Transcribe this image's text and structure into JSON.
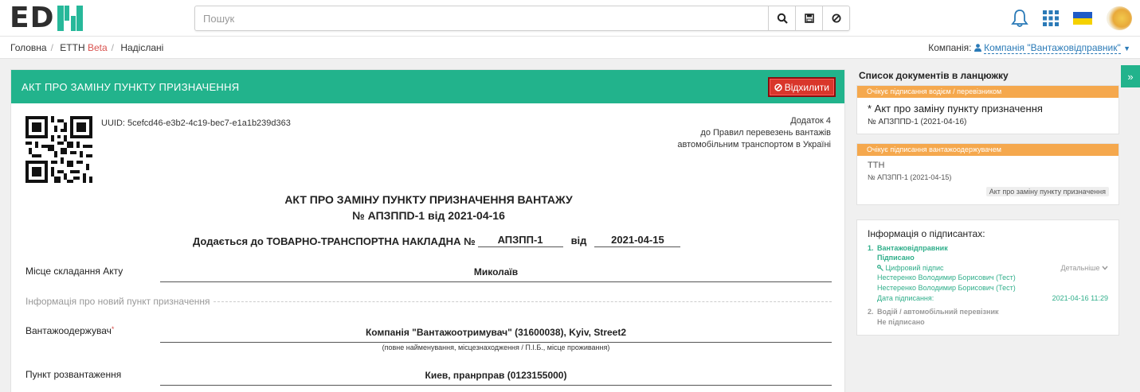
{
  "header": {
    "logo_text": "ED",
    "logo_letter_n": "N",
    "search_placeholder": "Пошук",
    "search_icons": [
      "search-icon",
      "save-icon",
      "clear-icon"
    ],
    "right_icons": [
      "bell-icon",
      "apps-grid-icon",
      "flag-ua-icon",
      "avatar"
    ],
    "accent_color": "#22b38c"
  },
  "breadcrumbs": {
    "home": "Головна",
    "section": "ЕТТН",
    "beta": "Beta",
    "current": "Надіслані"
  },
  "company": {
    "label": "Компанія:",
    "value": "Компанія \"Вантажовідправник\""
  },
  "document": {
    "header_title": "АКТ ПРО ЗАМІНУ ПУНКТУ ПРИЗНАЧЕННЯ",
    "reject_label": "Відхилити",
    "uuid": "UUID: 5cefcd46-e3b2-4c19-bec7-e1a1b239d363",
    "addendum": [
      "Додаток 4",
      "до Правил перевезень вантажів",
      "автомобільним транспортом в Україні"
    ],
    "title_line1": "АКТ ПРО ЗАМІНУ ПУНКТУ ПРИЗНАЧЕННЯ ВАНТАЖУ",
    "title_line2": "№ АПЗППD-1 від 2021-04-16",
    "ttn_prefix": "Додається до ТОВАРНО-ТРАНСПОРТНА НАКЛАДНА №",
    "ttn_number": "АПЗПП-1",
    "ttn_from": "від",
    "ttn_date": "2021-04-15",
    "place_label": "Місце складання Акту",
    "place_value": "Миколаїв",
    "new_point_section": "Інформація про новий пункт призначення",
    "consignee_label": "Вантажоодержувач",
    "consignee_required": "*",
    "consignee_value": "Компанія \"Вантажоотримувач\" (31600038), Kyiv, Street2",
    "consignee_hint": "(повне найменування, місцезнаходження / П.І.Б., місце проживання)",
    "unload_label": "Пункт розвантаження",
    "unload_value": "Киев, пранрправ (0123155000)"
  },
  "chain": {
    "title": "Список документів в ланцюжку",
    "toggle": "»",
    "cards": [
      {
        "badge": "Очікує підписання водієм / перевізником",
        "title": "* Акт про заміну пункту призначення",
        "subtitle": "№ АПЗППD-1 (2021-04-16)"
      },
      {
        "badge": "Очікує підписання вантажоодержувачем",
        "title": "ТТН",
        "subtitle": "№ АПЗПП-1 (2021-04-15)",
        "tag": "Акт про заміну пункту призначення"
      }
    ]
  },
  "signers": {
    "title": "Інформація о підписантах:",
    "items": [
      {
        "num": "1.",
        "name": "Вантажовідправник",
        "status": "Підписано",
        "sign_type": "Цифровий підпис",
        "details": "Детальніше",
        "person1": "Нестеренко Володимир Борисович (Тест)",
        "person2": "Нестеренко Володимир Борисович (Тест)",
        "date_label": "Дата підписання:",
        "date_value": "2021-04-16 11:29"
      },
      {
        "num": "2.",
        "name": "Водій / автомобільний перевізник",
        "status": "Не підписано"
      }
    ]
  }
}
